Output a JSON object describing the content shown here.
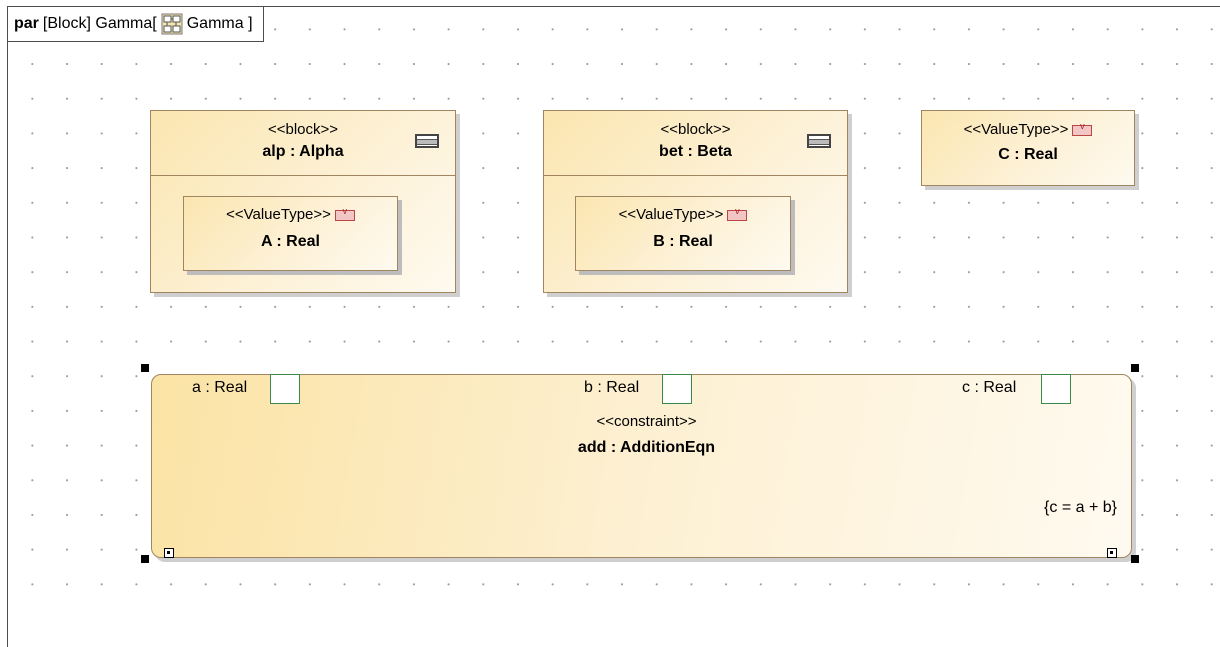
{
  "frame": {
    "keyword": "par",
    "title_prefix": "[Block] Gamma[",
    "title_block": "Gamma ]"
  },
  "blocks": [
    {
      "stereotype": "<<block>>",
      "name": "alp : Alpha",
      "part": {
        "stereotype": "<<ValueType>>",
        "name": "A : Real"
      }
    },
    {
      "stereotype": "<<block>>",
      "name": "bet : Beta",
      "part": {
        "stereotype": "<<ValueType>>",
        "name": "B : Real"
      }
    }
  ],
  "valuetype_c": {
    "stereotype": "<<ValueType>>",
    "name": "C : Real"
  },
  "constraint": {
    "stereotype": "<<constraint>>",
    "name": "add : AdditionEqn",
    "expression": "{c = a + b}",
    "params": [
      {
        "label": "a : Real"
      },
      {
        "label": "b : Real"
      },
      {
        "label": "c : Real"
      }
    ]
  },
  "colors": {
    "block_fill": "#fbe6b0",
    "block_border": "#a08560",
    "port_border": "#3a8a4a",
    "valuetype_icon": "#f3c6c6"
  },
  "icons": [
    "block-diagram-icon",
    "block-compartment-icon",
    "valuetype-icon"
  ]
}
